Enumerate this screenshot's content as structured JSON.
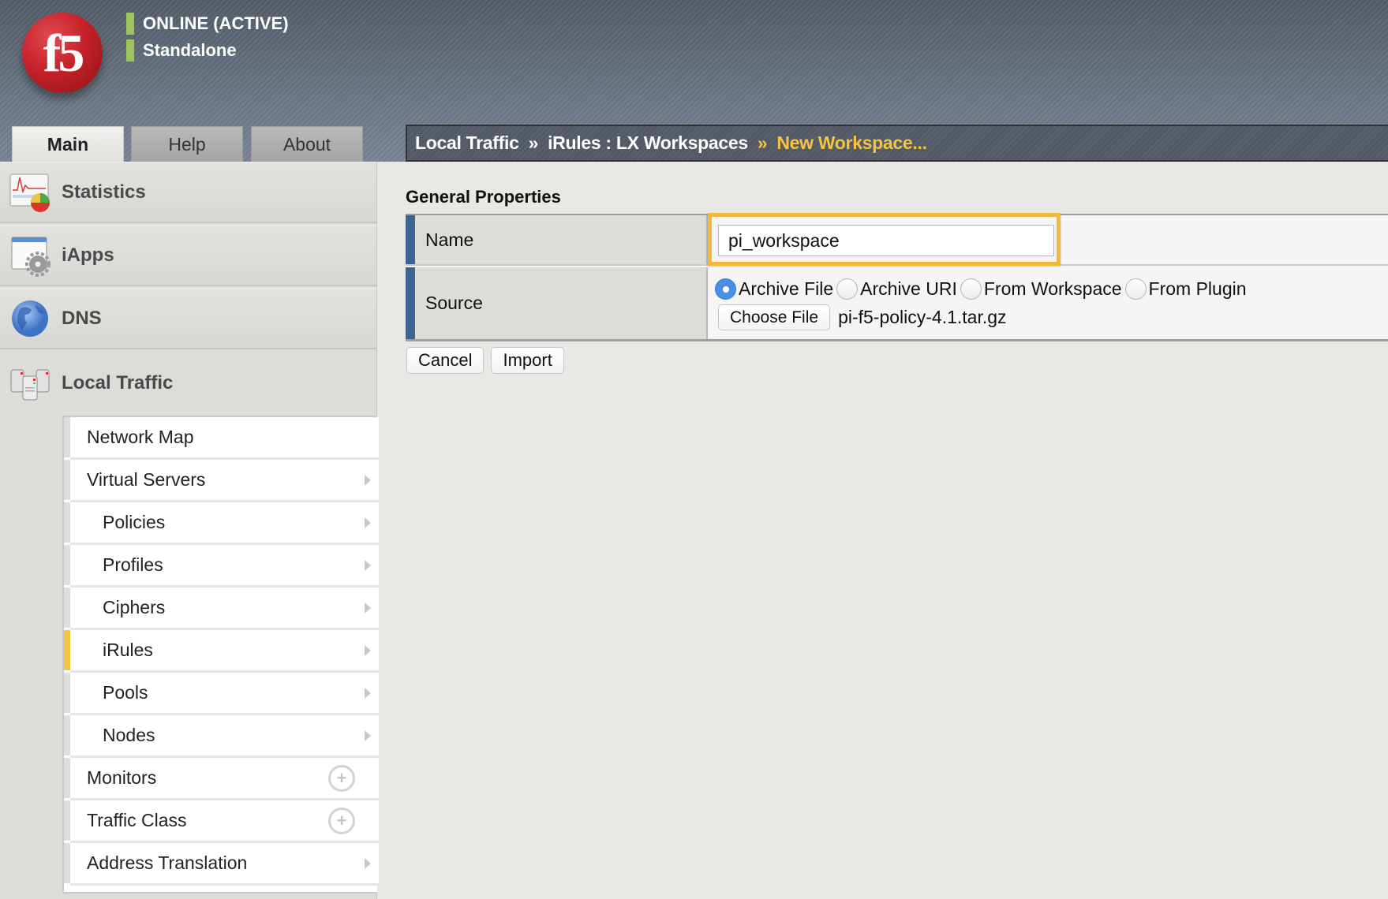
{
  "header": {
    "logo_text": "f5",
    "status_lines": [
      "ONLINE (ACTIVE)",
      "Standalone"
    ],
    "status_color": "#9cc45a",
    "tabs": [
      {
        "label": "Main",
        "active": true
      },
      {
        "label": "Help",
        "active": false
      },
      {
        "label": "About",
        "active": false
      }
    ],
    "breadcrumb": {
      "items": [
        "Local Traffic",
        "iRules : LX Workspaces"
      ],
      "separator": "»",
      "current": "New Workspace..."
    }
  },
  "sidebar": {
    "sections": [
      {
        "label": "Statistics",
        "icon": "statistics-icon"
      },
      {
        "label": "iApps",
        "icon": "iapps-icon"
      },
      {
        "label": "DNS",
        "icon": "dns-globe-icon"
      },
      {
        "label": "Local Traffic",
        "icon": "local-traffic-icon"
      }
    ],
    "submenu": [
      {
        "label": "Network Map",
        "indent": false,
        "control": "none",
        "active": false
      },
      {
        "label": "Virtual Servers",
        "indent": false,
        "control": "arrow",
        "active": false
      },
      {
        "label": "Policies",
        "indent": true,
        "control": "arrow",
        "active": false
      },
      {
        "label": "Profiles",
        "indent": true,
        "control": "arrow",
        "active": false
      },
      {
        "label": "Ciphers",
        "indent": true,
        "control": "arrow",
        "active": false
      },
      {
        "label": "iRules",
        "indent": true,
        "control": "arrow",
        "active": true
      },
      {
        "label": "Pools",
        "indent": true,
        "control": "arrow",
        "active": false
      },
      {
        "label": "Nodes",
        "indent": true,
        "control": "arrow",
        "active": false
      },
      {
        "label": "Monitors",
        "indent": false,
        "control": "plus",
        "active": false
      },
      {
        "label": "Traffic Class",
        "indent": false,
        "control": "plus",
        "active": false
      },
      {
        "label": "Address Translation",
        "indent": false,
        "control": "arrow",
        "active": false
      }
    ],
    "active_color": "#f5c542"
  },
  "main": {
    "section_title": "General Properties",
    "name_label": "Name",
    "name_value": "pi_workspace",
    "source_label": "Source",
    "source_options": [
      {
        "label": "Archive File",
        "checked": true
      },
      {
        "label": "Archive URI",
        "checked": false
      },
      {
        "label": "From Workspace",
        "checked": false
      },
      {
        "label": "From Plugin",
        "checked": false
      }
    ],
    "choose_file_label": "Choose File",
    "file_name": "pi-f5-policy-4.1.tar.gz",
    "cancel_label": "Cancel",
    "import_label": "Import",
    "highlight_color": "#f0b93c",
    "label_bar_color": "#3e6491"
  }
}
